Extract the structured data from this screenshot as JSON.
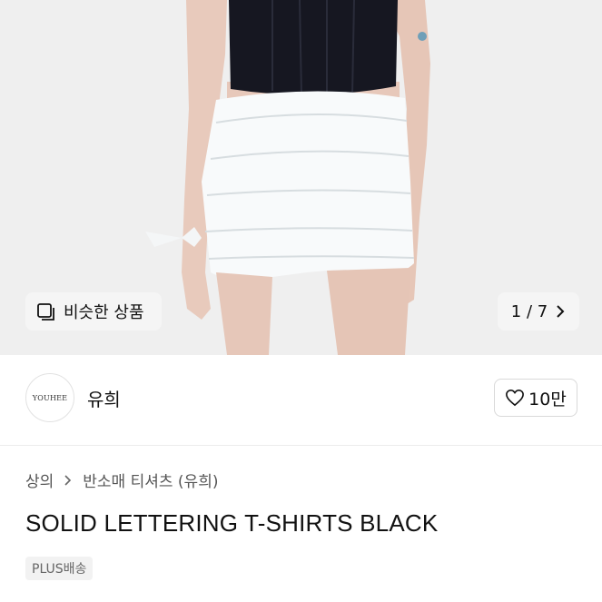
{
  "gallery": {
    "similar_label": "비슷한 상품",
    "similar_icon": "similar-items-icon",
    "counter": "1 / 7",
    "next_icon": "chevron-right-icon"
  },
  "seller": {
    "avatar_text": "YOUHEE",
    "name": "유희",
    "like_icon": "heart-icon",
    "like_count": "10만"
  },
  "breadcrumb": {
    "category": "상의",
    "subcategory": "반소매 티셔츠 (유희)",
    "separator_icon": "chevron-right-icon"
  },
  "product": {
    "title": "SOLID LETTERING T-SHIRTS BLACK",
    "badge": "PLUS배송"
  }
}
